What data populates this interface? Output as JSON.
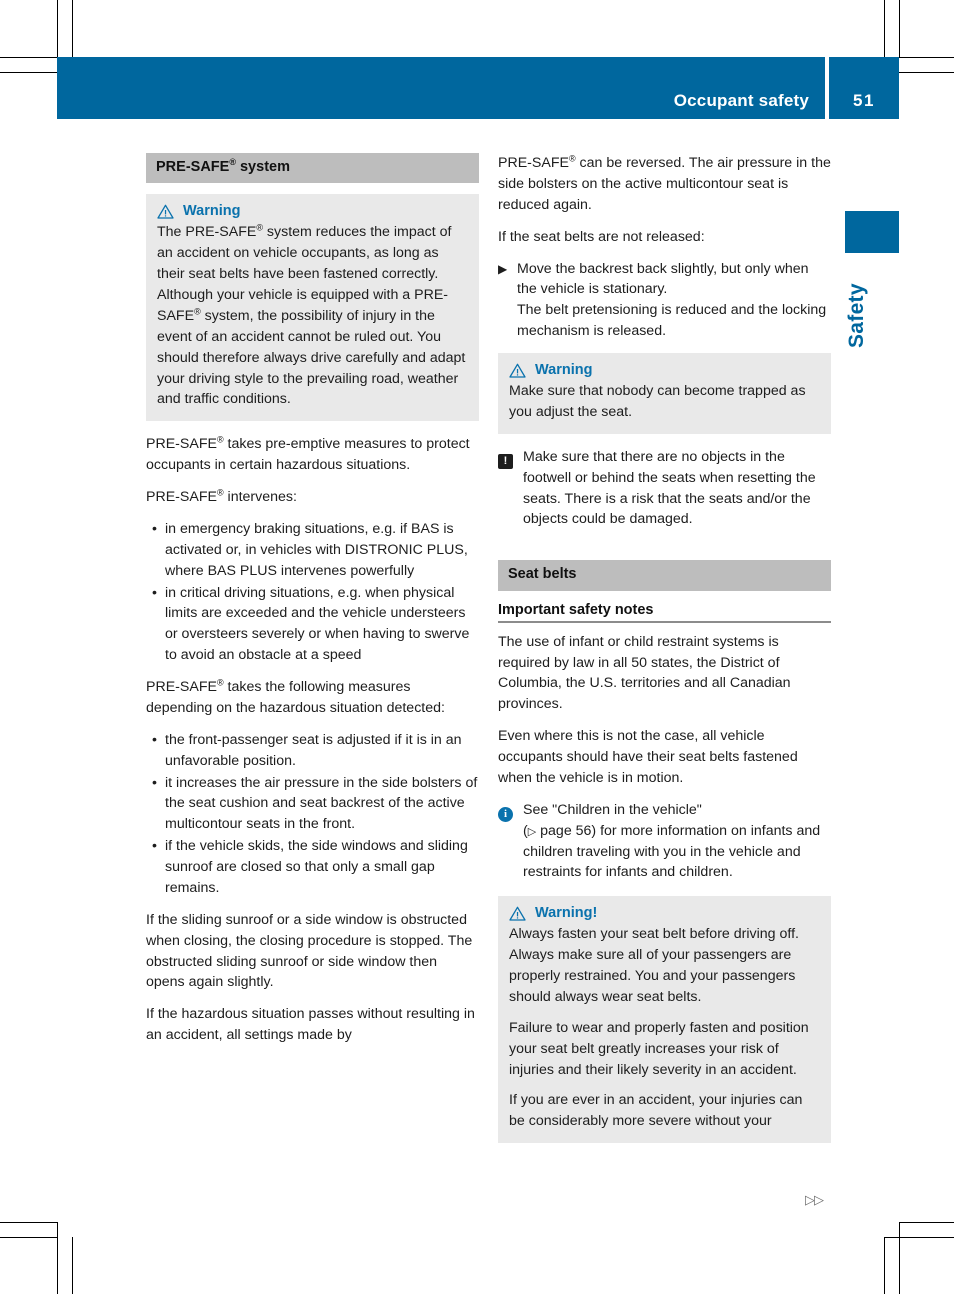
{
  "header": {
    "title": "Occupant safety",
    "page_number": "51"
  },
  "side_tab": {
    "label": "Safety"
  },
  "colors": {
    "brand_blue": "#00679e",
    "accent_blue": "#0a72ad",
    "section_bar_gray": "#bdbdbd",
    "box_gray": "#e9e9e9"
  },
  "left_column": {
    "section_title_html": "PRE-SAFE<sup class=\"reg\">&reg;</sup> system",
    "warning_box": {
      "icon": "warning-triangle-icon",
      "heading": "Warning",
      "paragraphs_html": [
        "The PRE-SAFE<sup class=\"reg\">&reg;</sup> system reduces the impact of an accident on vehicle occupants, as long as their seat belts have been fastened correctly. Although your vehicle is equipped with a PRE-SAFE<sup class=\"reg\">&reg;</sup> system, the possibility of injury in the event of an accident cannot be ruled out. You should therefore always drive carefully and adapt your driving style to the prevailing road, weather and traffic conditions."
      ]
    },
    "para_1_html": "PRE-SAFE<sup class=\"reg\">&reg;</sup> takes pre-emptive measures to protect occupants in certain hazardous situations.",
    "para_2_html": "PRE-SAFE<sup class=\"reg\">&reg;</sup> intervenes:",
    "bullets_1": [
      "in emergency braking situations, e.g. if BAS is activated or, in vehicles with DISTRONIC PLUS, where BAS PLUS intervenes powerfully",
      "in critical driving situations, e.g. when physical limits are exceeded and the vehicle understeers or oversteers severely or when having to swerve to avoid an obstacle at a speed"
    ],
    "para_3_html": "PRE-SAFE<sup class=\"reg\">&reg;</sup> takes the following measures depending on the hazardous situation detected:",
    "bullets_2": [
      "the front-passenger seat is adjusted if it is in an unfavorable position.",
      "it increases the air pressure in the side bolsters of the seat cushion and seat backrest of the active multicontour seats in the front.",
      "if the vehicle skids, the side windows and sliding sunroof are closed so that only a small gap remains."
    ],
    "para_4": "If the sliding sunroof or a side window is obstructed when closing, the closing procedure is stopped. The obstructed sliding sunroof or side window then opens again slightly.",
    "para_5": "If the hazardous situation passes without resulting in an accident, all settings made by"
  },
  "right_column": {
    "para_1_html": "PRE-SAFE<sup class=\"reg\">&reg;</sup> can be reversed. The air pressure in the side bolsters on the active multicontour seat is reduced again.",
    "para_2": "If the seat belts are not released:",
    "step_1": "Move the backrest back slightly, but only when the vehicle is stationary.\nThe belt pretensioning is reduced and the locking mechanism is released.",
    "warning_box_1": {
      "icon": "warning-triangle-icon",
      "heading": "Warning",
      "paragraphs": [
        "Make sure that nobody can become trapped as you adjust the seat."
      ]
    },
    "caution_note": {
      "icon": "exclamation-box-icon",
      "text": "Make sure that there are no objects in the footwell or behind the seats when resetting the seats. There is a risk that the seats and/or the objects could be damaged."
    },
    "section_title": "Seat belts",
    "sub_head": "Important safety notes",
    "para_3": "The use of infant or child restraint systems is required by law in all 50 states, the District of Columbia, the U.S. territories and all Canadian provinces.",
    "para_4": "Even where this is not the case, all vehicle occupants should have their seat belts fastened when the vehicle is in motion.",
    "info_note": {
      "icon": "info-circle-icon",
      "text_html": "See \"Children in the vehicle\"<br>(<span class=\"pgref-tri\">&#9655;</span> page 56) for more information on infants and children traveling with you in the vehicle and restraints for infants and children."
    },
    "warning_box_2": {
      "icon": "warning-triangle-icon",
      "heading": "Warning!",
      "paragraphs": [
        "Always fasten your seat belt before driving off. Always make sure all of your passengers are properly restrained. You and your passengers should always wear seat belts.",
        "Failure to wear and properly fasten and position your seat belt greatly increases your risk of injuries and their likely severity in an accident.",
        "If you are ever in an accident, your injuries can be considerably more severe without your"
      ]
    }
  },
  "footer": {
    "continuation_marker": "▷▷"
  }
}
